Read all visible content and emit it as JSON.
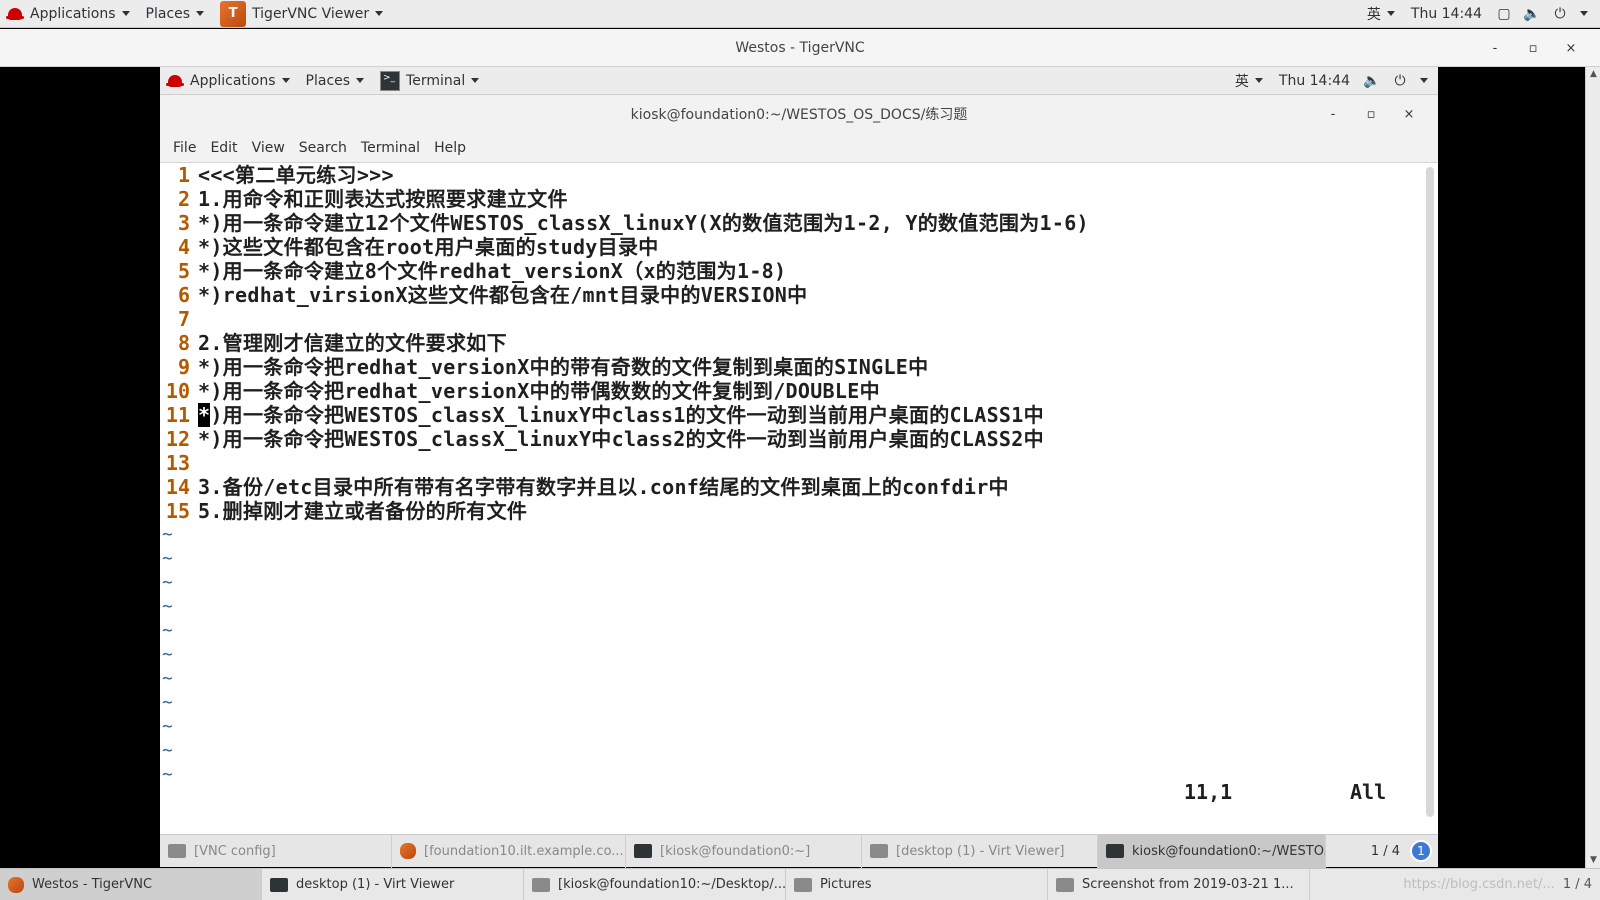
{
  "host_panel": {
    "applications": "Applications",
    "places": "Places",
    "active_app": "TigerVNC Viewer",
    "ime": "英",
    "clock": "Thu 14:44"
  },
  "vnc_window": {
    "title": "Westos - TigerVNC",
    "minimize": "-",
    "maximize": "▫",
    "close": "×"
  },
  "remote_panel": {
    "applications": "Applications",
    "places": "Places",
    "active_app": "Terminal",
    "ime": "英",
    "clock": "Thu 14:44"
  },
  "terminal": {
    "title": "kiosk@foundation0:~/WESTOS_OS_DOCS/练习题",
    "menu": [
      "File",
      "Edit",
      "View",
      "Search",
      "Terminal",
      "Help"
    ],
    "lines": [
      {
        "n": "1",
        "text": "<<<第二单元练习>>>"
      },
      {
        "n": "2",
        "text": "1.用命令和正则表达式按照要求建立文件"
      },
      {
        "n": "3",
        "text": "*)用一条命令建立12个文件WESTOS_classX_linuxY(X的数值范围为1-2, Y的数值范围为1-6)"
      },
      {
        "n": "4",
        "text": "*)这些文件都包含在root用户桌面的study目录中"
      },
      {
        "n": "5",
        "text": "*)用一条命令建立8个文件redhat_versionX（x的范围为1-8)"
      },
      {
        "n": "6",
        "text": "*)redhat_virsionX这些文件都包含在/mnt目录中的VERSION中"
      },
      {
        "n": "7",
        "text": ""
      },
      {
        "n": "8",
        "text": "2.管理刚才信建立的文件要求如下"
      },
      {
        "n": "9",
        "text": "*)用一条命令把redhat_versionX中的带有奇数的文件复制到桌面的SINGLE中"
      },
      {
        "n": "10",
        "text": "*)用一条命令把redhat_versionX中的带偶数数的文件复制到/DOUBLE中"
      },
      {
        "n": "11",
        "text": ")用一条命令把WESTOS_classX_linuxY中class1的文件一动到当前用户桌面的CLASS1中",
        "cursor": "*"
      },
      {
        "n": "12",
        "text": "*)用一条命令把WESTOS_classX_linuxY中class2的文件一动到当前用户桌面的CLASS2中"
      },
      {
        "n": "13",
        "text": ""
      },
      {
        "n": "14",
        "text": "3.备份/etc目录中所有带有名字带有数字并且以.conf结尾的文件到桌面上的confdir中"
      },
      {
        "n": "15",
        "text": "5.删掉刚才建立或者备份的所有文件"
      }
    ],
    "tilde": "~",
    "status_pos": "11,1",
    "status_all": "All"
  },
  "remote_taskbar": {
    "tasks": [
      "[VNC config]",
      "[foundation10.ilt.example.co...",
      "[kiosk@foundation0:~]",
      "[desktop (1) - Virt Viewer]",
      "kiosk@foundation0:~/WESTO..."
    ],
    "pager": "1 / 4",
    "badge": "1"
  },
  "host_taskbar": {
    "tasks": [
      "Westos - TigerVNC",
      "desktop (1) - Virt Viewer",
      "[kiosk@foundation10:~/Desktop/...",
      "Pictures",
      "Screenshot from 2019-03-21 1..."
    ],
    "watermark": "https://blog.csdn.net/...",
    "pager": "1 / 4"
  }
}
